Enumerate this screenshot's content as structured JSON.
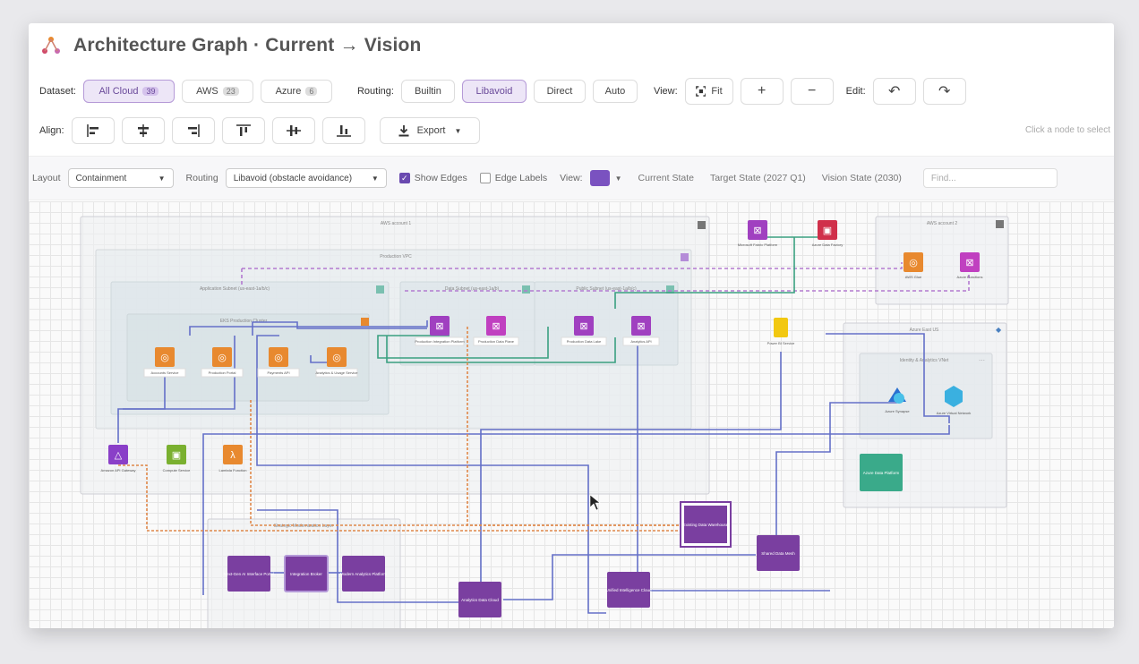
{
  "app": {
    "title": "Architecture Graph · Current → Vision"
  },
  "toolbar": {
    "dataset_label": "Dataset:",
    "datasets": [
      {
        "label": "All Cloud",
        "count": "39",
        "active": true
      },
      {
        "label": "AWS",
        "count": "23",
        "active": false
      },
      {
        "label": "Azure",
        "count": "6",
        "active": false
      }
    ],
    "routing_label": "Routing:",
    "routing": [
      {
        "label": "Builtin",
        "active": false
      },
      {
        "label": "Libavoid",
        "active": true
      },
      {
        "label": "Direct",
        "active": false
      },
      {
        "label": "Auto",
        "active": false
      }
    ],
    "view_label": "View:",
    "fit_label": "Fit",
    "edit_label": "Edit:",
    "align_label": "Align:",
    "export_label": "Export",
    "hint": "Click a node to select"
  },
  "subbar": {
    "layout_label": "Layout",
    "layout_value": "Containment",
    "routing_label": "Routing",
    "routing_value": "Libavoid (obstacle avoidance)",
    "show_edges": "Show Edges",
    "edge_labels": "Edge Labels",
    "view_label": "View:",
    "states": [
      "Current State",
      "Target State (2027 Q1)",
      "Vision State (2030)"
    ],
    "find_placeholder": "Find..."
  },
  "colors": {
    "accent": "#7a52c0",
    "aws": "#e8892f",
    "purple_node": "#a040c0",
    "box": "#7a3fa0",
    "edge_blue": "#6470c8",
    "edge_green": "#3aa080",
    "edge_orange": "#e0884a"
  },
  "graph": {
    "nodes": [
      {
        "label": "Accounts Service"
      },
      {
        "label": "Production Portal"
      },
      {
        "label": "Payments API"
      },
      {
        "label": "Analytics & Usage Service"
      },
      {
        "label": "Production Integration Platform"
      },
      {
        "label": "Production Data Plane"
      },
      {
        "label": "Production Data Lake"
      },
      {
        "label": "Analytics API"
      },
      {
        "label": "Amazon API Gateway"
      },
      {
        "label": "Compute Service"
      },
      {
        "label": "Lambda Function"
      },
      {
        "label": "Microsoft Fabric Platform"
      },
      {
        "label": "Azure Data Factory"
      },
      {
        "label": "AWS Glue"
      },
      {
        "label": "Azure Functions"
      },
      {
        "label": "Azure Synapse"
      },
      {
        "label": "Power BI Service"
      },
      {
        "label": "Azure Data Platform"
      },
      {
        "label": "Azure Virtual Network"
      }
    ],
    "boxes": [
      {
        "label": "Next-Gen AI Interface Portal"
      },
      {
        "label": "Integration Broker"
      },
      {
        "label": "Modern Analytics Platform"
      },
      {
        "label": "Existing Data Warehouse"
      },
      {
        "label": "Analytics Data Cloud"
      },
      {
        "label": "Unified Intelligence Cloud"
      },
      {
        "label": "Shared Data Mesh"
      }
    ],
    "groups": [
      {
        "label": "AWS account 1"
      },
      {
        "label": "Production VPC"
      },
      {
        "label": "Application Subnet (us-east-1a/b/c)"
      },
      {
        "label": "Data Subnet (us-east-1a/b)"
      },
      {
        "label": "Public Subnet (us-east-1a/b/c)"
      },
      {
        "label": "EKS Production Cluster"
      },
      {
        "label": "AWS account 2"
      },
      {
        "label": "Azure East US"
      },
      {
        "label": "Identity & Analytics VNet"
      },
      {
        "label": "Strategic Modernization Layer"
      }
    ]
  }
}
